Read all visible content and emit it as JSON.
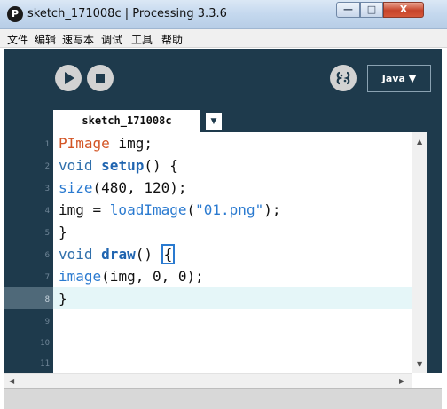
{
  "window": {
    "title": "sketch_171008c | Processing 3.3.6",
    "app_icon": "P",
    "controls": {
      "minimize": "—",
      "maximize": "□",
      "close": "X"
    }
  },
  "menu": {
    "items": [
      "文件",
      "编辑",
      "速写本",
      "调试",
      "工具",
      "帮助"
    ]
  },
  "toolbar": {
    "run_icon": "play-icon",
    "stop_icon": "stop-icon",
    "debug_icon": "debugger-icon",
    "mode": "Java ▼"
  },
  "tabs": {
    "active": "sketch_171008c",
    "menu_arrow": "▼"
  },
  "editor": {
    "line_numbers": [
      "1",
      "2",
      "3",
      "4",
      "5",
      "6",
      "7",
      "8",
      "9",
      "10",
      "11"
    ],
    "current_line": "8",
    "code": {
      "l1_type": "PImage",
      "l1_rest": " img;",
      "l2_kw": "void",
      "l2_fn": "setup",
      "l2_rest": "() {",
      "l3_fn": "size",
      "l3_rest": "(480, 120);",
      "l4_pre": "img = ",
      "l4_fn": "loadImage",
      "l4_open": "(",
      "l4_str": "\"01.png\"",
      "l4_close": ");",
      "l5": "}",
      "l6_kw": "void",
      "l6_fn": "draw",
      "l6_rest": "() ",
      "l6_brace": "{",
      "l7_fn": "image",
      "l7_rest": "(img, 0, 0);",
      "l8": "}"
    }
  },
  "colors": {
    "toolbar_bg": "#1e3a4c",
    "keyword": "#2f6fab",
    "type": "#d35525",
    "string": "#2a7ad0",
    "current_line": "#e5f6f8"
  }
}
